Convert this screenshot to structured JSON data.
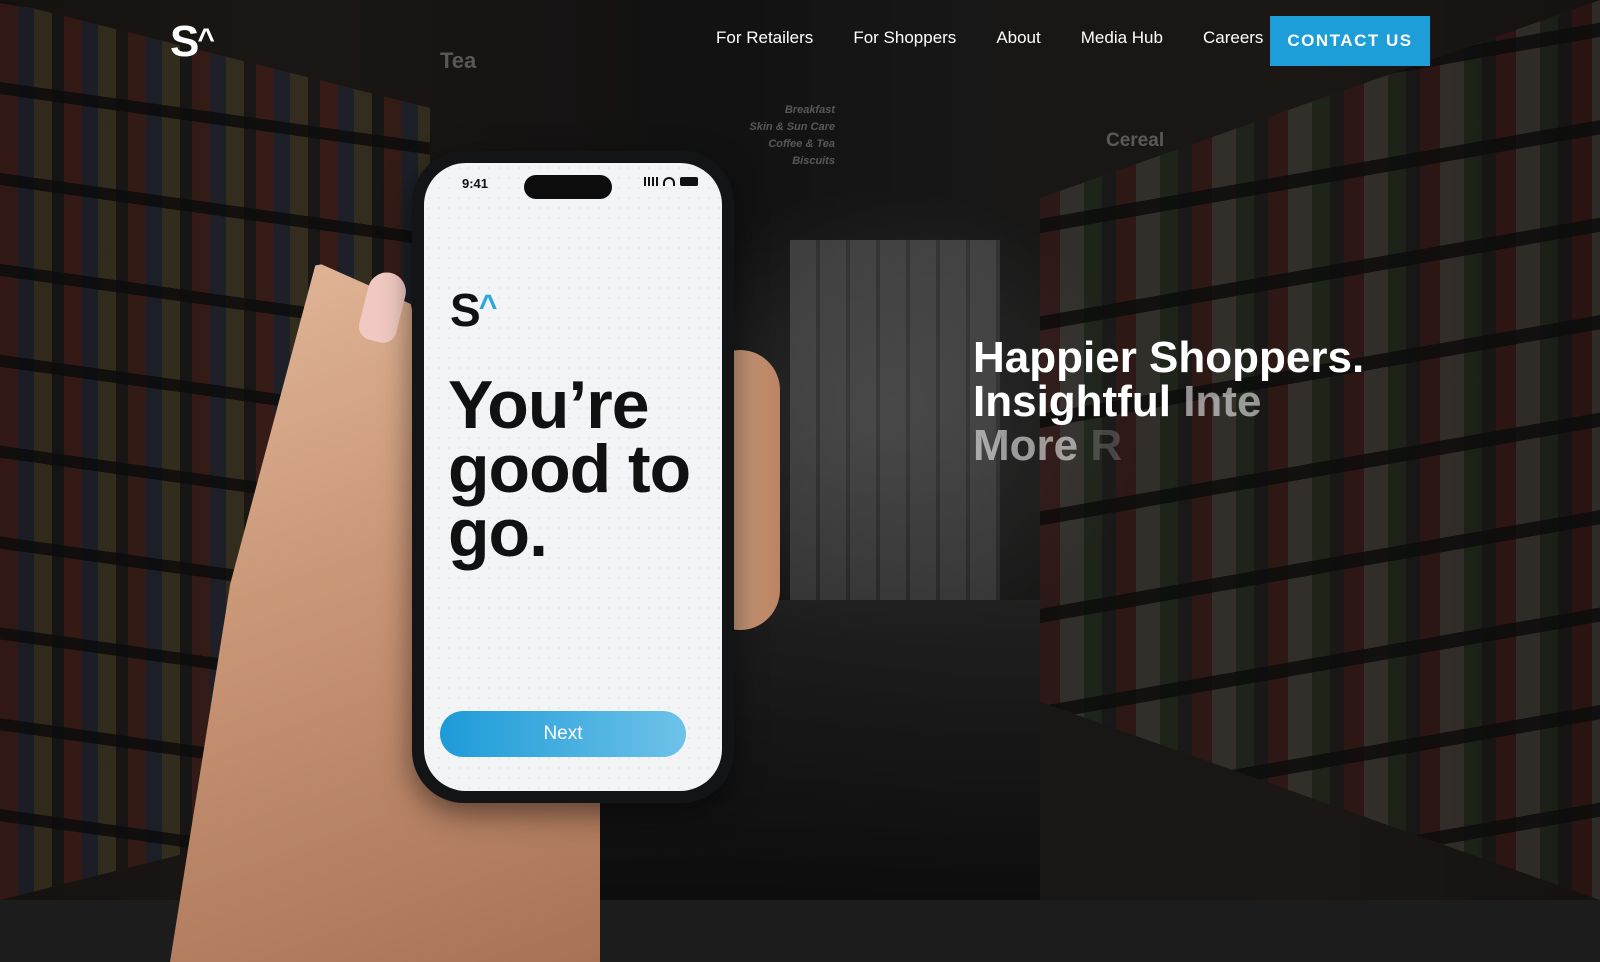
{
  "brand": {
    "logo_text": "S",
    "logo_caret": "^"
  },
  "nav": {
    "items": [
      "For Retailers",
      "For Shoppers",
      "About",
      "Media Hub",
      "Careers"
    ],
    "cta_label": "CONTACT US"
  },
  "hero": {
    "line1": "Happier Shoppers.",
    "line2_solid": "Insightful",
    "line2_fading": "Inte",
    "line3_fading": "More",
    "line3_fading_more": "R"
  },
  "store_signs": {
    "tea": "Tea",
    "cereal": "Cereal",
    "categories": [
      "Breakfast",
      "Skin & Sun Care",
      "Coffee & Tea",
      "Biscuits"
    ]
  },
  "phone": {
    "status_time": "9:41",
    "app_logo_text": "S",
    "app_logo_caret": "^",
    "headline": "You’re good to go.",
    "button_label": "Next"
  },
  "colors": {
    "accent": "#1d9ed9",
    "text": "#ffffff",
    "dark": "#111111"
  }
}
